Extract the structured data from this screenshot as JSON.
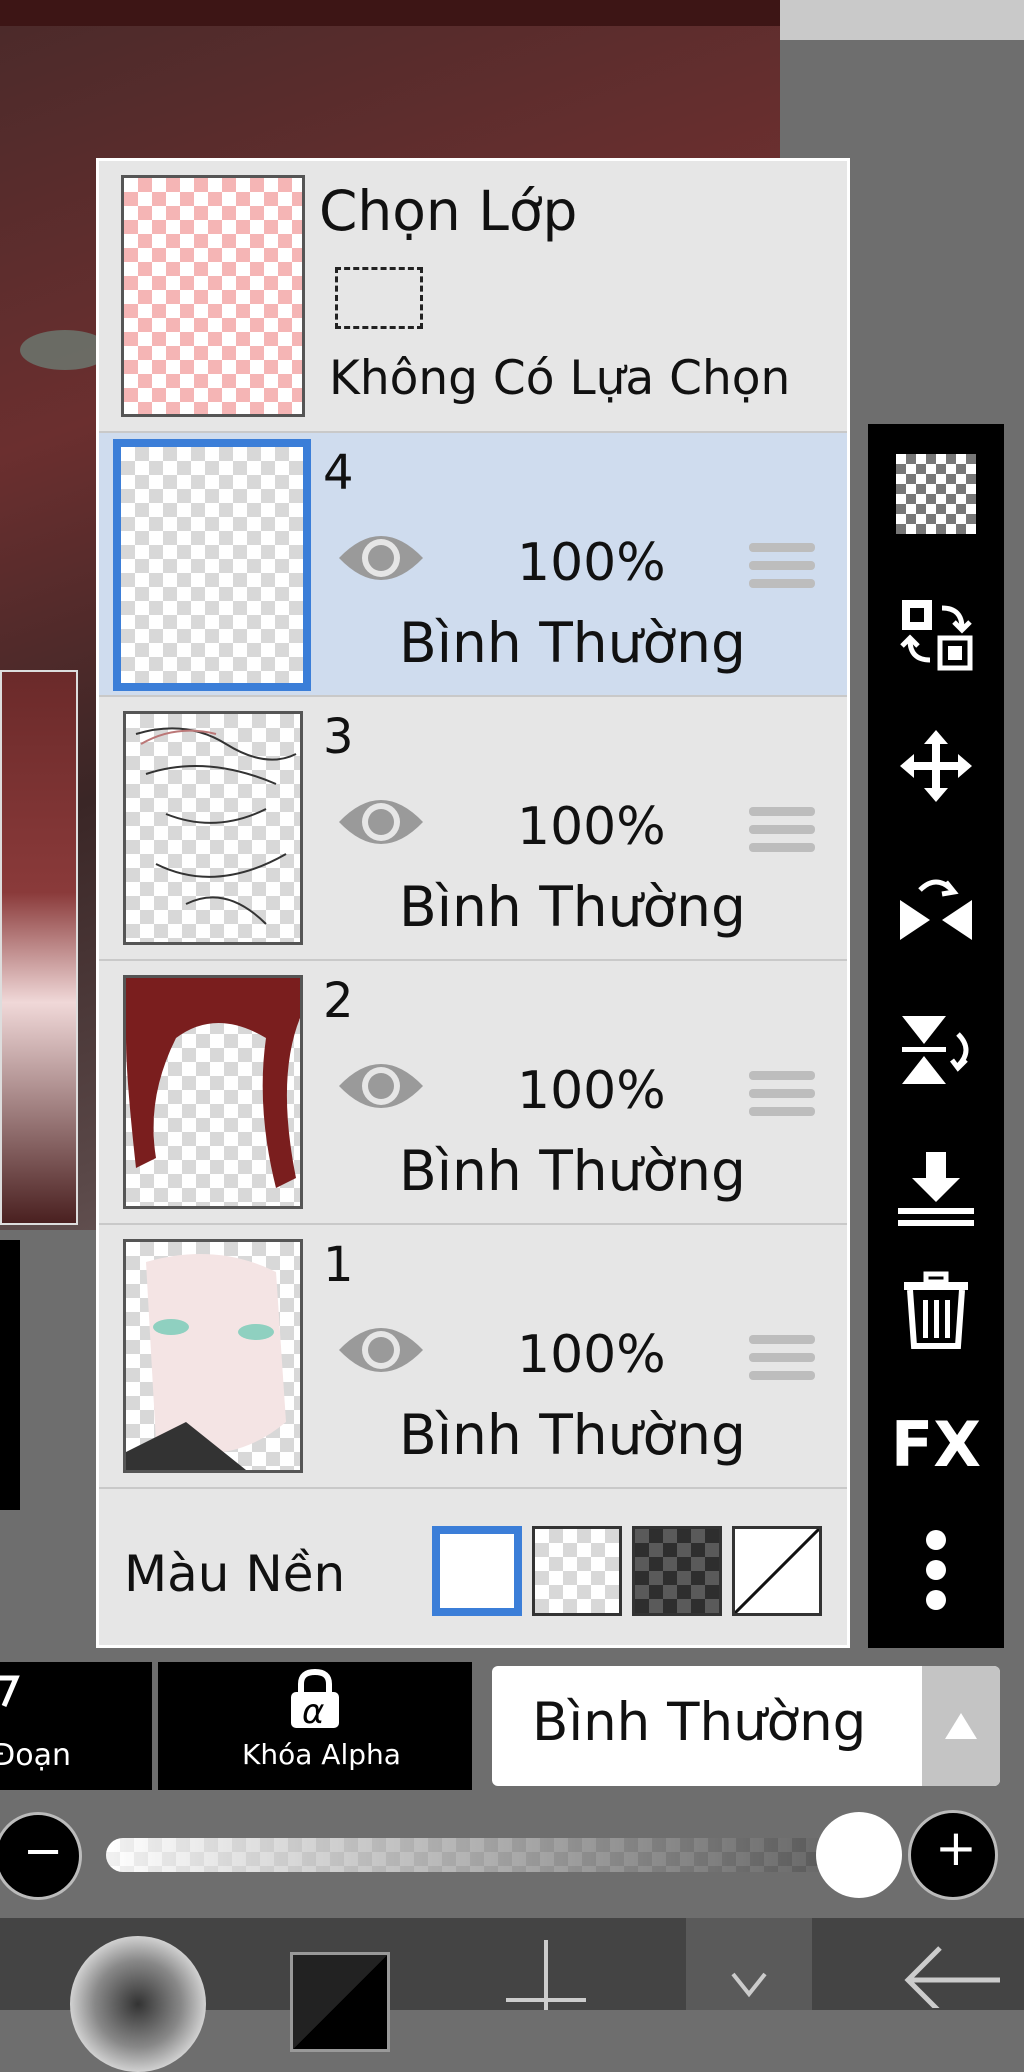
{
  "selection_layer": {
    "title": "Chọn Lớp",
    "subtitle": "Không Có Lựa Chọn"
  },
  "layers": [
    {
      "number": "4",
      "opacity": "100%",
      "mode": "Bình Thường",
      "selected": true
    },
    {
      "number": "3",
      "opacity": "100%",
      "mode": "Bình Thường",
      "selected": false
    },
    {
      "number": "2",
      "opacity": "100%",
      "mode": "Bình Thường",
      "selected": false
    },
    {
      "number": "1",
      "opacity": "100%",
      "mode": "Bình Thường",
      "selected": false
    }
  ],
  "background": {
    "label": "Màu Nền",
    "options": [
      "white",
      "transparent-light",
      "transparent-dark",
      "none"
    ],
    "selected": "white"
  },
  "toolbar": {
    "icons": [
      "transparent-layer-icon",
      "swap-layers-icon",
      "move-icon",
      "flip-horizontal-icon",
      "flip-vertical-icon",
      "merge-down-icon",
      "trash-icon",
      "fx-icon",
      "more-icon"
    ],
    "fx_label": "FX"
  },
  "bottom_bar": {
    "clipping_label": "Đoạn",
    "alpha_lock_label": "Khóa Alpha",
    "alpha_glyph": "α",
    "blend_mode_value": "Bình Thường"
  },
  "opacity_slider": {
    "value": 1.0,
    "minus": "−",
    "plus": "+"
  },
  "colors": {
    "selected_row": "#cfdcee",
    "selected_border": "#3b7ed8",
    "panel": "#e6e6e6",
    "toolbar": "#000000"
  }
}
